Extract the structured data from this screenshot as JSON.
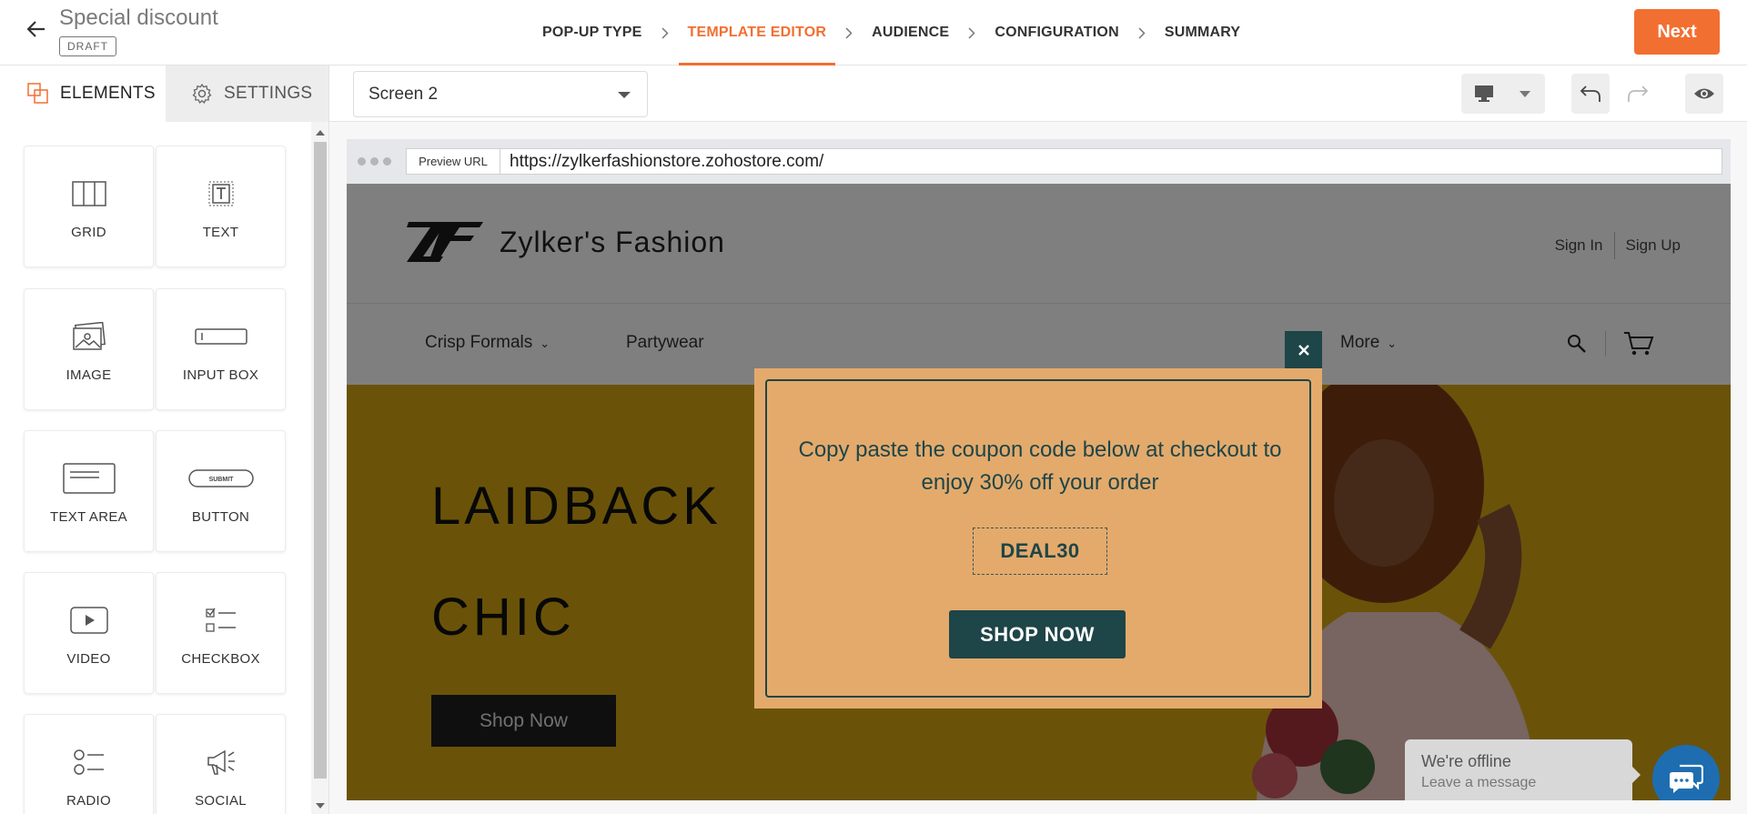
{
  "header": {
    "title": "Special discount",
    "status_badge": "DRAFT",
    "steps": [
      "POP-UP TYPE",
      "TEMPLATE EDITOR",
      "AUDIENCE",
      "CONFIGURATION",
      "SUMMARY"
    ],
    "active_step": "TEMPLATE EDITOR",
    "next_label": "Next"
  },
  "left_panel": {
    "tabs": [
      {
        "label": "ELEMENTS",
        "icon": "elements-icon",
        "active": true
      },
      {
        "label": "SETTINGS",
        "icon": "gear-icon",
        "active": false
      }
    ],
    "elements": [
      {
        "label": "GRID",
        "icon": "grid-icon"
      },
      {
        "label": "TEXT",
        "icon": "text-icon"
      },
      {
        "label": "IMAGE",
        "icon": "image-icon"
      },
      {
        "label": "INPUT BOX",
        "icon": "input-box-icon"
      },
      {
        "label": "TEXT AREA",
        "icon": "text-area-icon"
      },
      {
        "label": "BUTTON",
        "icon": "button-icon",
        "icon_text": "SUBMIT"
      },
      {
        "label": "VIDEO",
        "icon": "video-icon"
      },
      {
        "label": "CHECKBOX",
        "icon": "checkbox-icon"
      },
      {
        "label": "RADIO",
        "icon": "radio-icon"
      },
      {
        "label": "SOCIAL",
        "icon": "social-icon"
      }
    ]
  },
  "toolbar": {
    "screen_selected": "Screen 2",
    "device_icon": "desktop-icon",
    "undo_icon": "undo-icon",
    "redo_icon": "redo-icon",
    "preview_icon": "eye-icon"
  },
  "preview": {
    "url_label": "Preview URL",
    "url": "https://zylkerfashionstore.zohostore.com/",
    "site": {
      "brand": "Zylker's Fashion",
      "sign_in": "Sign In",
      "sign_up": "Sign Up",
      "nav": [
        "Crisp Formals",
        "Partywear",
        "More"
      ],
      "hero_line1": "LAIDBACK",
      "hero_line2": "CHIC",
      "hero_button": "Shop Now"
    },
    "popup": {
      "message": "Copy paste the coupon code below at checkout to enjoy 30% off your order",
      "coupon_code": "DEAL30",
      "button": "SHOP NOW",
      "colors": {
        "background": "#e3aa6c",
        "accent": "#1e4548"
      }
    },
    "chat": {
      "title": "We're offline",
      "subtitle": "Leave a message"
    }
  },
  "colors": {
    "brand": "#f26f32",
    "hero": "#d4a612",
    "chat": "#1e6db1"
  }
}
